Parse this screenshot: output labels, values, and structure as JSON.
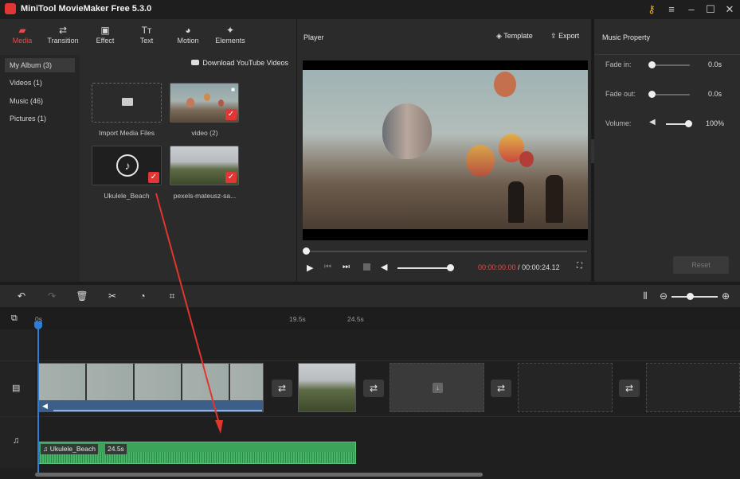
{
  "app": {
    "title": "MiniTool MovieMaker Free 5.3.0"
  },
  "tabs": [
    {
      "label": "Media",
      "icon": "folder-icon"
    },
    {
      "label": "Transition",
      "icon": "swap-icon"
    },
    {
      "label": "Effect",
      "icon": "effect-icon"
    },
    {
      "label": "Text",
      "icon": "text-icon"
    },
    {
      "label": "Motion",
      "icon": "motion-icon"
    },
    {
      "label": "Elements",
      "icon": "elements-icon"
    }
  ],
  "sidebar": {
    "items": [
      {
        "label": "My Album (3)"
      },
      {
        "label": "Videos (1)"
      },
      {
        "label": "Music (46)"
      },
      {
        "label": "Pictures (1)"
      }
    ]
  },
  "media": {
    "download_label": "Download YouTube Videos",
    "import_label": "Import Media Files",
    "items": [
      {
        "caption": "video (2)"
      },
      {
        "caption": "Ukulele_Beach"
      },
      {
        "caption": "pexels-mateusz-sa..."
      }
    ]
  },
  "player": {
    "title": "Player",
    "template_label": "Template",
    "export_label": "Export",
    "current_time": "00:00:00.00",
    "separator": " / ",
    "total_time": "00:00:24.12"
  },
  "music_property": {
    "title": "Music Property",
    "fade_in_label": "Fade in:",
    "fade_in_value": "0.0s",
    "fade_out_label": "Fade out:",
    "fade_out_value": "0.0s",
    "volume_label": "Volume:",
    "volume_value": "100%",
    "reset_label": "Reset"
  },
  "timeline": {
    "ruler": {
      "start": "0s",
      "mark1": "19.5s",
      "mark2": "24.5s"
    },
    "audio_clip": {
      "name": "Ukulele_Beach",
      "duration": "24.5s"
    }
  },
  "colors": {
    "accent": "#e84a4a",
    "audio_clip": "#3aa55a",
    "timecode": "#e84a4a"
  }
}
